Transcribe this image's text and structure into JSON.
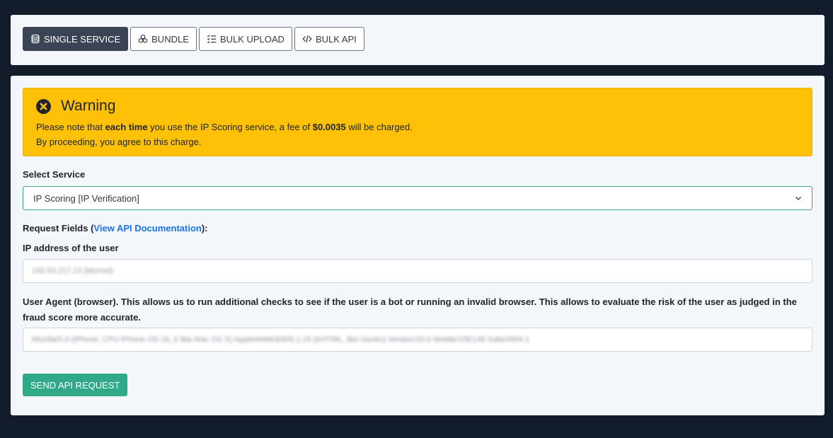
{
  "tabs": [
    {
      "label": "SINGLE SERVICE",
      "icon": "database-icon",
      "active": true
    },
    {
      "label": "BUNDLE",
      "icon": "boxes-icon",
      "active": false
    },
    {
      "label": "BULK UPLOAD",
      "icon": "checklist-icon",
      "active": false
    },
    {
      "label": "BULK API",
      "icon": "code-icon",
      "active": false
    }
  ],
  "warning": {
    "title": "Warning",
    "icon": "x-circle-icon",
    "line1_pre": "Please note that ",
    "line1_bold": "each time",
    "line1_mid": " you use the IP Scoring service, a fee of ",
    "line1_fee": "$0.0035",
    "line1_post": " will be charged.",
    "line2": "By proceeding, you agree to this charge."
  },
  "service": {
    "label": "Select Service",
    "selected": "IP Scoring [IP Verification]"
  },
  "request": {
    "label_pre": "Request Fields (",
    "link": "View API Documentation",
    "label_post": "):"
  },
  "fields": {
    "ip_label": "IP address of the user",
    "ip_value": "192.53.217.13 (blurred)",
    "ua_label": "User Agent (browser). This allows us to run additional checks to see if the user is a bot or running an invalid browser. This allows to evaluate the risk of the user as judged in the fraud score more accurate.",
    "ua_value": "Mozilla/5.0 (iPhone; CPU iPhone OS 16_6 like Mac OS X) AppleWebKit/605.1.15 (KHTML, like Gecko) Version/16.6 Mobile/15E148 Safari/604.1"
  },
  "actions": {
    "send_label": "SEND API REQUEST"
  },
  "colors": {
    "background": "#131c2b",
    "card": "#f3f6fb",
    "warning": "#ffc107",
    "primary_button": "#2fa987",
    "active_tab": "#3b4455",
    "link": "#1a73e8"
  }
}
